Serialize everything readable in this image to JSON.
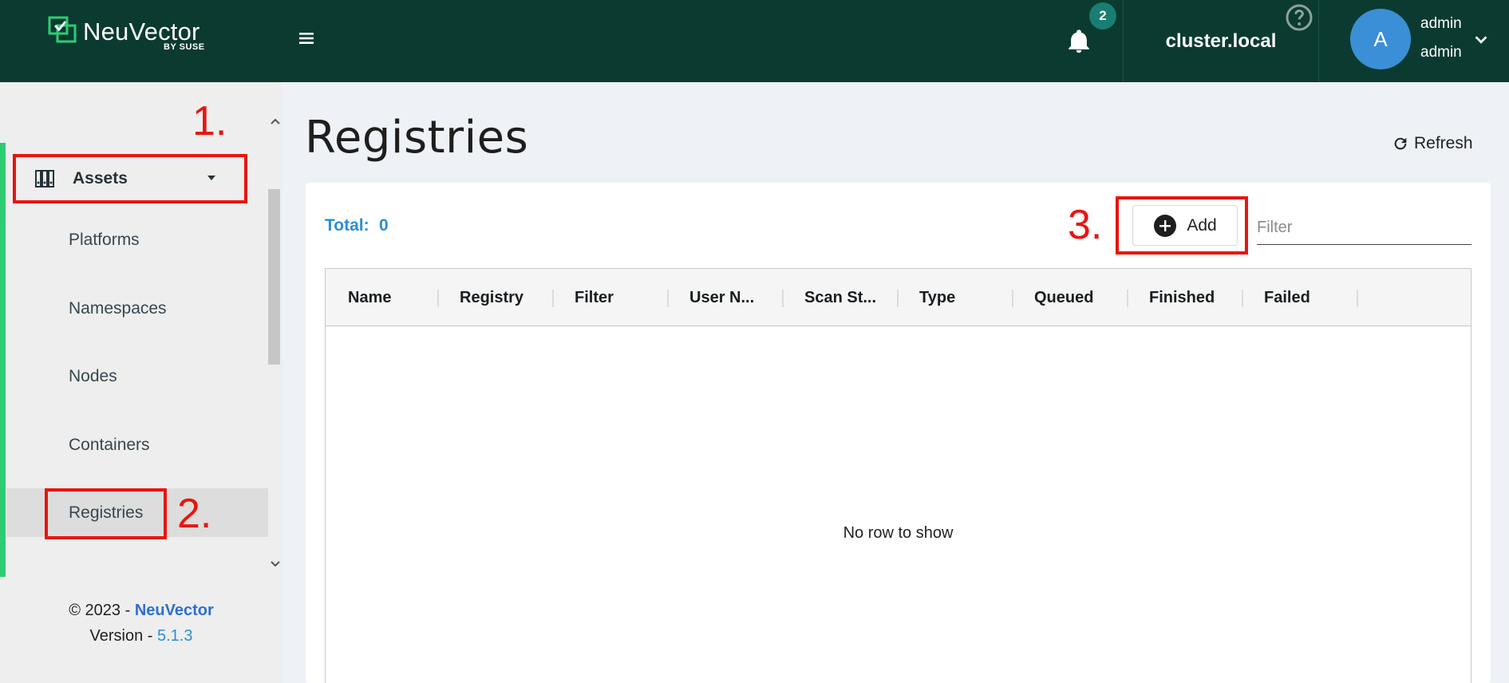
{
  "header": {
    "brand": "NeuVector",
    "brand_sub": "BY SUSE",
    "notification_count": "2",
    "cluster_name": "cluster.local",
    "avatar_initial": "A",
    "user_name": "admin",
    "user_role": "admin",
    "icons": [
      "hamburger-menu-icon",
      "bell-icon",
      "help-icon",
      "chevron-down-icon"
    ]
  },
  "sidebar": {
    "section_label": "Assets",
    "items": [
      {
        "label": "Platforms"
      },
      {
        "label": "Namespaces"
      },
      {
        "label": "Nodes"
      },
      {
        "label": "Containers"
      },
      {
        "label": "Registries",
        "active": true
      }
    ],
    "footer_copy": "© 2023 - ",
    "footer_brand": "NeuVector",
    "footer_version_label": "Version - ",
    "footer_version": "5.1.3"
  },
  "annotations": [
    "1.",
    "2.",
    "3."
  ],
  "main": {
    "title": "Registries",
    "refresh_label": "Refresh",
    "total_label": "Total:",
    "total_value": "0",
    "add_label": "Add",
    "filter_placeholder": "Filter",
    "columns": [
      "Name",
      "Registry",
      "Filter",
      "User N...",
      "Scan St...",
      "Type",
      "Queued",
      "Finished",
      "Failed"
    ],
    "empty_text": "No row to show"
  },
  "colors": {
    "header_bg": "#0b3a30",
    "accent_green": "#2ecc71",
    "link_blue": "#2a8fd4",
    "annotation_red": "#e8150f",
    "avatar_blue": "#3b8fd6"
  }
}
